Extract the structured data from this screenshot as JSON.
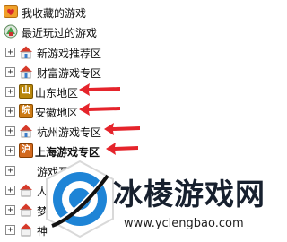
{
  "tree": {
    "favorites_label": "我收藏的游戏",
    "recent_label": "最近玩过的游戏",
    "items": [
      {
        "label": "新游戏推荐区"
      },
      {
        "label": "财富游戏专区"
      },
      {
        "label": "山东地区"
      },
      {
        "label": "安徽地区"
      },
      {
        "label": "杭州游戏专区"
      },
      {
        "label": "上海游戏专区"
      },
      {
        "label": "游戏互通区"
      }
    ],
    "shandong_icon_text": "山",
    "anhui_icon_text": "皖",
    "shanghai_icon_text": "沪",
    "hidden_item_partial_1": "人",
    "hidden_item_partial_2": "梦",
    "hidden_item_partial_3": "神"
  },
  "watermark": {
    "title": "冰棱游戏网",
    "url": "www.yclengbao.com"
  },
  "colors": {
    "arrow": "#e5242b",
    "highlight": "#3f8fe6",
    "logo_blue": "#1e84d6"
  }
}
